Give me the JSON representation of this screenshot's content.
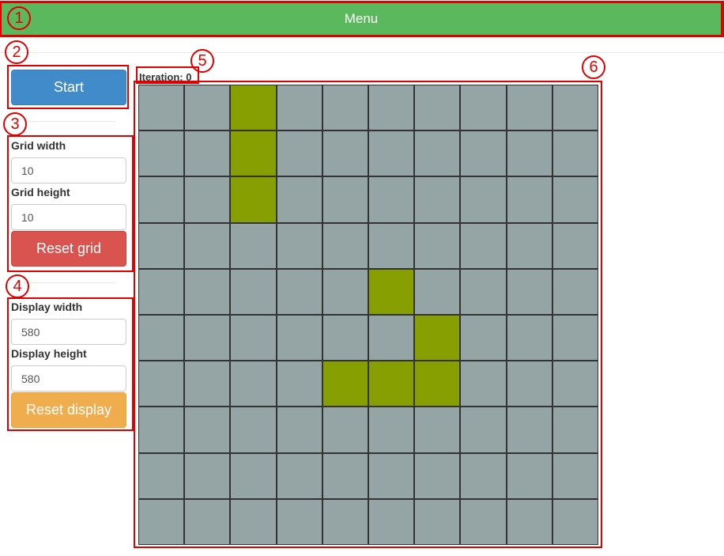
{
  "menu": {
    "label": "Menu"
  },
  "controls": {
    "start_label": "Start",
    "grid_width_label": "Grid width",
    "grid_width_value": "10",
    "grid_height_label": "Grid height",
    "grid_height_value": "10",
    "reset_grid_label": "Reset grid",
    "display_width_label": "Display width",
    "display_width_value": "580",
    "display_height_label": "Display height",
    "display_height_value": "580",
    "reset_display_label": "Reset display"
  },
  "status": {
    "iteration_text": "Iteration: 0"
  },
  "annotations": [
    "1",
    "2",
    "3",
    "4",
    "5",
    "6"
  ],
  "colors": {
    "menu_bg": "#5cb85c",
    "start_bg": "#428bca",
    "reset_grid_bg": "#d9534f",
    "reset_display_bg": "#f0ad4e",
    "dead_cell": "#95a5a6",
    "alive_cell": "#879f00",
    "annotation_red": "#e00000"
  },
  "grid": {
    "cols": 10,
    "rows": 10,
    "alive": [
      [
        0,
        2
      ],
      [
        1,
        2
      ],
      [
        2,
        2
      ],
      [
        4,
        5
      ],
      [
        5,
        6
      ],
      [
        6,
        4
      ],
      [
        6,
        5
      ],
      [
        6,
        6
      ]
    ]
  }
}
